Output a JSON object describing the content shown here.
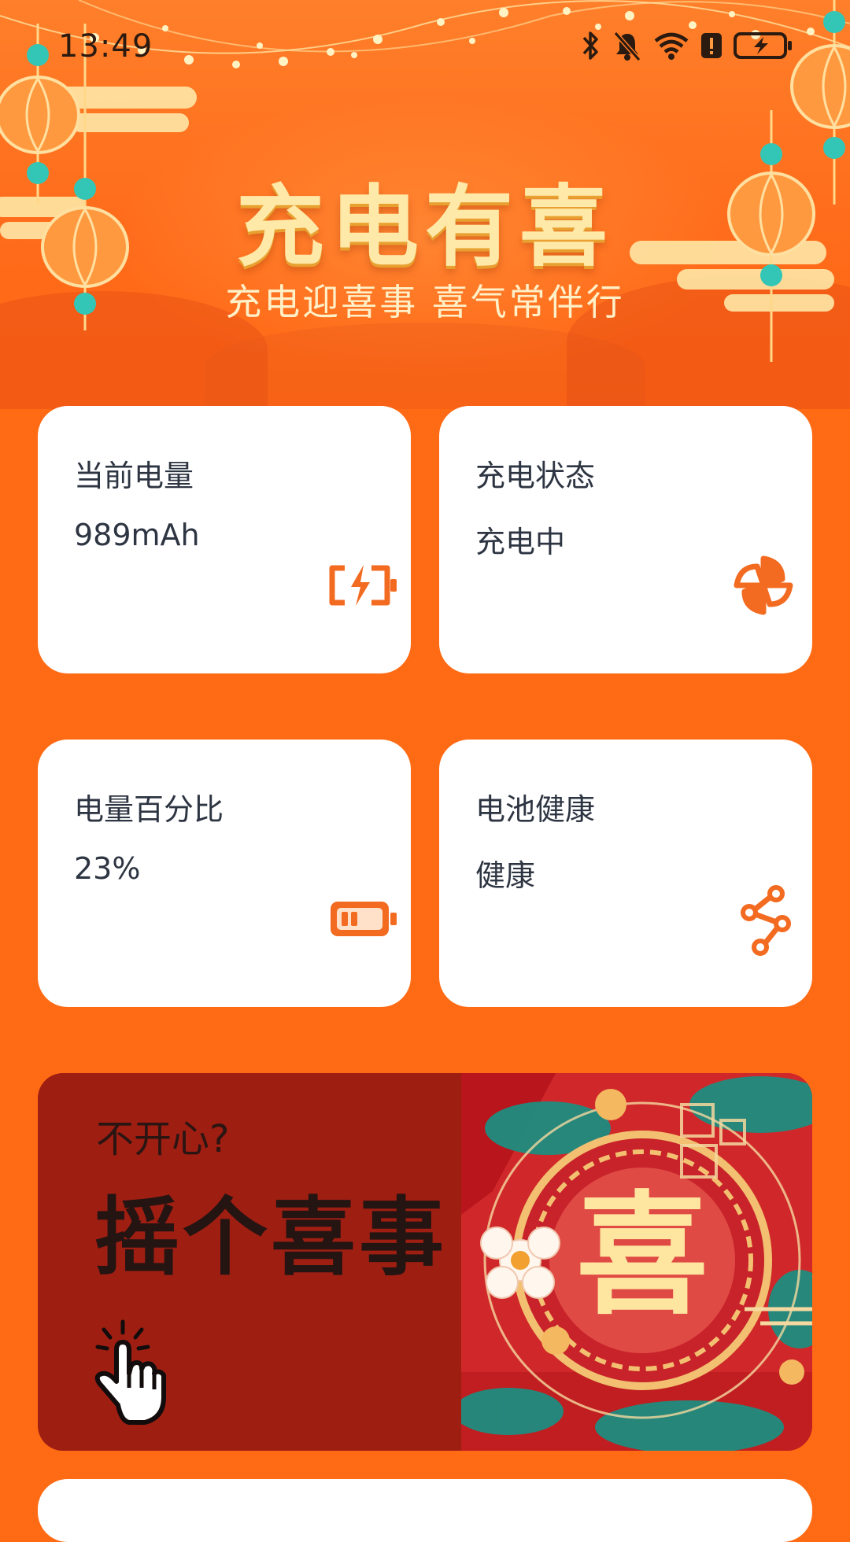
{
  "status_bar": {
    "time": "13:49",
    "icons": [
      "bluetooth-icon",
      "bell-muted-icon",
      "wifi-icon",
      "alert-icon",
      "battery-charging-icon"
    ]
  },
  "hero": {
    "title": "充电有喜",
    "subtitle": "充电迎喜事 喜气常伴行"
  },
  "cards": [
    {
      "label": "当前电量",
      "value": "989mAh",
      "icon": "battery-charging-icon"
    },
    {
      "label": "充电状态",
      "value": "充电中",
      "icon": "pinwheel-icon"
    },
    {
      "label": "电量百分比",
      "value": "23%",
      "icon": "battery-level-icon"
    },
    {
      "label": "电池健康",
      "value": "健康",
      "icon": "branch-nodes-icon"
    }
  ],
  "promo": {
    "small_text": "不开心?",
    "big_text": "摇个喜事",
    "badge_char": "喜",
    "icon": "tap-hand-icon"
  },
  "colors": {
    "background": "#FF6B14",
    "card": "#FFFFFF",
    "accent": "#F36B21",
    "promo_bg": "#9E1E12",
    "gold": "#FFE9A8"
  }
}
